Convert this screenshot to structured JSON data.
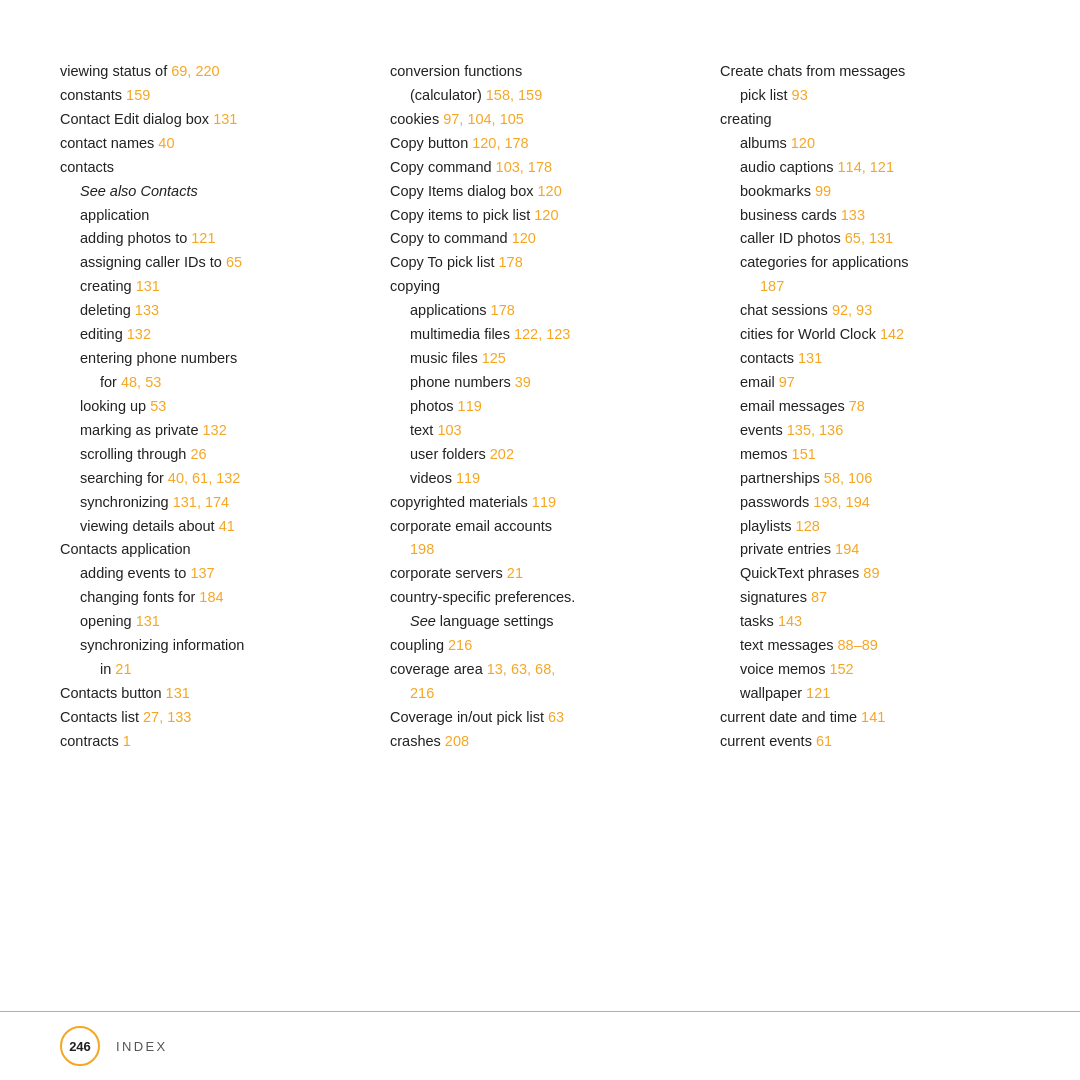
{
  "page": {
    "number": "246",
    "footer_label": "INDEX"
  },
  "columns": [
    {
      "id": "col1",
      "entries": [
        {
          "text": "viewing status of ",
          "nums": "69, 220",
          "indent": 0
        },
        {
          "text": "constants ",
          "nums": "159",
          "indent": 0
        },
        {
          "text": "Contact Edit dialog box ",
          "nums": "131",
          "indent": 0
        },
        {
          "text": "contact names ",
          "nums": "40",
          "indent": 0
        },
        {
          "text": "contacts",
          "nums": "",
          "indent": 0
        },
        {
          "text": "See also Contacts",
          "nums": "",
          "indent": 1,
          "italic": true
        },
        {
          "text": "    application",
          "nums": "",
          "indent": 1
        },
        {
          "text": "adding photos to ",
          "nums": "121",
          "indent": 1
        },
        {
          "text": "assigning caller IDs to ",
          "nums": "65",
          "indent": 1
        },
        {
          "text": "creating ",
          "nums": "131",
          "indent": 1
        },
        {
          "text": "deleting ",
          "nums": "133",
          "indent": 1
        },
        {
          "text": "editing ",
          "nums": "132",
          "indent": 1
        },
        {
          "text": "entering phone numbers",
          "nums": "",
          "indent": 1
        },
        {
          "text": "    for ",
          "nums": "48, 53",
          "indent": 2
        },
        {
          "text": "looking up ",
          "nums": "53",
          "indent": 1
        },
        {
          "text": "marking as private ",
          "nums": "132",
          "indent": 1
        },
        {
          "text": "scrolling through ",
          "nums": "26",
          "indent": 1
        },
        {
          "text": "searching for ",
          "nums": "40, 61, 132",
          "indent": 1
        },
        {
          "text": "synchronizing ",
          "nums": "131, 174",
          "indent": 1
        },
        {
          "text": "viewing details about ",
          "nums": "41",
          "indent": 1
        },
        {
          "text": "Contacts application",
          "nums": "",
          "indent": 0
        },
        {
          "text": "adding events to ",
          "nums": "137",
          "indent": 1
        },
        {
          "text": "changing fonts for ",
          "nums": "184",
          "indent": 1
        },
        {
          "text": "opening ",
          "nums": "131",
          "indent": 1
        },
        {
          "text": "synchronizing information",
          "nums": "",
          "indent": 1
        },
        {
          "text": "    in ",
          "nums": "21",
          "indent": 2
        },
        {
          "text": "Contacts button ",
          "nums": "131",
          "indent": 0
        },
        {
          "text": "Contacts list ",
          "nums": "27, 133",
          "indent": 0
        },
        {
          "text": "contracts ",
          "nums": "1",
          "indent": 0
        }
      ]
    },
    {
      "id": "col2",
      "entries": [
        {
          "text": "conversion functions",
          "nums": "",
          "indent": 0
        },
        {
          "text": "    (calculator) ",
          "nums": "158, 159",
          "indent": 1
        },
        {
          "text": "cookies ",
          "nums": "97, 104, 105",
          "indent": 0
        },
        {
          "text": "Copy button ",
          "nums": "120, 178",
          "indent": 0
        },
        {
          "text": "Copy command ",
          "nums": "103, 178",
          "indent": 0
        },
        {
          "text": "Copy Items dialog box ",
          "nums": "120",
          "indent": 0
        },
        {
          "text": "Copy items to pick list ",
          "nums": "120",
          "indent": 0
        },
        {
          "text": "Copy to command ",
          "nums": "120",
          "indent": 0
        },
        {
          "text": "Copy To pick list ",
          "nums": "178",
          "indent": 0
        },
        {
          "text": "copying",
          "nums": "",
          "indent": 0
        },
        {
          "text": "applications ",
          "nums": "178",
          "indent": 1
        },
        {
          "text": "multimedia files ",
          "nums": "122, 123",
          "indent": 1
        },
        {
          "text": "music files ",
          "nums": "125",
          "indent": 1
        },
        {
          "text": "phone numbers ",
          "nums": "39",
          "indent": 1
        },
        {
          "text": "photos ",
          "nums": "119",
          "indent": 1
        },
        {
          "text": "text ",
          "nums": "103",
          "indent": 1
        },
        {
          "text": "user folders ",
          "nums": "202",
          "indent": 1
        },
        {
          "text": "videos ",
          "nums": "119",
          "indent": 1
        },
        {
          "text": "copyrighted materials ",
          "nums": "119",
          "indent": 0
        },
        {
          "text": "corporate email accounts",
          "nums": "",
          "indent": 0
        },
        {
          "text": "    198",
          "nums": "",
          "indent": 1,
          "numonly": "198"
        },
        {
          "text": "corporate servers ",
          "nums": "21",
          "indent": 0
        },
        {
          "text": "country-specific preferences.",
          "nums": "",
          "indent": 0
        },
        {
          "text": "    See language settings",
          "nums": "",
          "indent": 1,
          "italic_see": true
        },
        {
          "text": "coupling ",
          "nums": "216",
          "indent": 0
        },
        {
          "text": "coverage area ",
          "nums": "13, 63, 68,",
          "indent": 0
        },
        {
          "text": "    216",
          "nums": "",
          "indent": 1,
          "numonly": "216"
        },
        {
          "text": "Coverage in/out pick list ",
          "nums": "63",
          "indent": 0
        },
        {
          "text": "crashes ",
          "nums": "208",
          "indent": 0
        }
      ]
    },
    {
      "id": "col3",
      "entries": [
        {
          "text": "Create chats from messages",
          "nums": "",
          "indent": 0
        },
        {
          "text": "pick list ",
          "nums": "93",
          "indent": 1
        },
        {
          "text": "creating",
          "nums": "",
          "indent": 0
        },
        {
          "text": "albums ",
          "nums": "120",
          "indent": 1
        },
        {
          "text": "audio captions ",
          "nums": "114, 121",
          "indent": 1
        },
        {
          "text": "bookmarks ",
          "nums": "99",
          "indent": 1
        },
        {
          "text": "business cards ",
          "nums": "133",
          "indent": 1
        },
        {
          "text": "caller ID photos ",
          "nums": "65, 131",
          "indent": 1
        },
        {
          "text": "categories for applications",
          "nums": "",
          "indent": 1
        },
        {
          "text": "    187",
          "nums": "",
          "indent": 2,
          "numonly": "187"
        },
        {
          "text": "chat sessions ",
          "nums": "92, 93",
          "indent": 1
        },
        {
          "text": "cities for World Clock ",
          "nums": "142",
          "indent": 1
        },
        {
          "text": "contacts ",
          "nums": "131",
          "indent": 1
        },
        {
          "text": "email ",
          "nums": "97",
          "indent": 1
        },
        {
          "text": "email messages ",
          "nums": "78",
          "indent": 1
        },
        {
          "text": "events ",
          "nums": "135, 136",
          "indent": 1
        },
        {
          "text": "memos ",
          "nums": "151",
          "indent": 1
        },
        {
          "text": "partnerships ",
          "nums": "58, 106",
          "indent": 1
        },
        {
          "text": "passwords ",
          "nums": "193, 194",
          "indent": 1
        },
        {
          "text": "playlists ",
          "nums": "128",
          "indent": 1
        },
        {
          "text": "private entries ",
          "nums": "194",
          "indent": 1
        },
        {
          "text": "QuickText phrases ",
          "nums": "89",
          "indent": 1
        },
        {
          "text": "signatures ",
          "nums": "87",
          "indent": 1
        },
        {
          "text": "tasks ",
          "nums": "143",
          "indent": 1
        },
        {
          "text": "text messages ",
          "nums": "88–89",
          "indent": 1
        },
        {
          "text": "voice memos ",
          "nums": "152",
          "indent": 1
        },
        {
          "text": "wallpaper ",
          "nums": "121",
          "indent": 1
        },
        {
          "text": "current date and time ",
          "nums": "141",
          "indent": 0
        },
        {
          "text": "current events ",
          "nums": "61",
          "indent": 0
        }
      ]
    }
  ]
}
